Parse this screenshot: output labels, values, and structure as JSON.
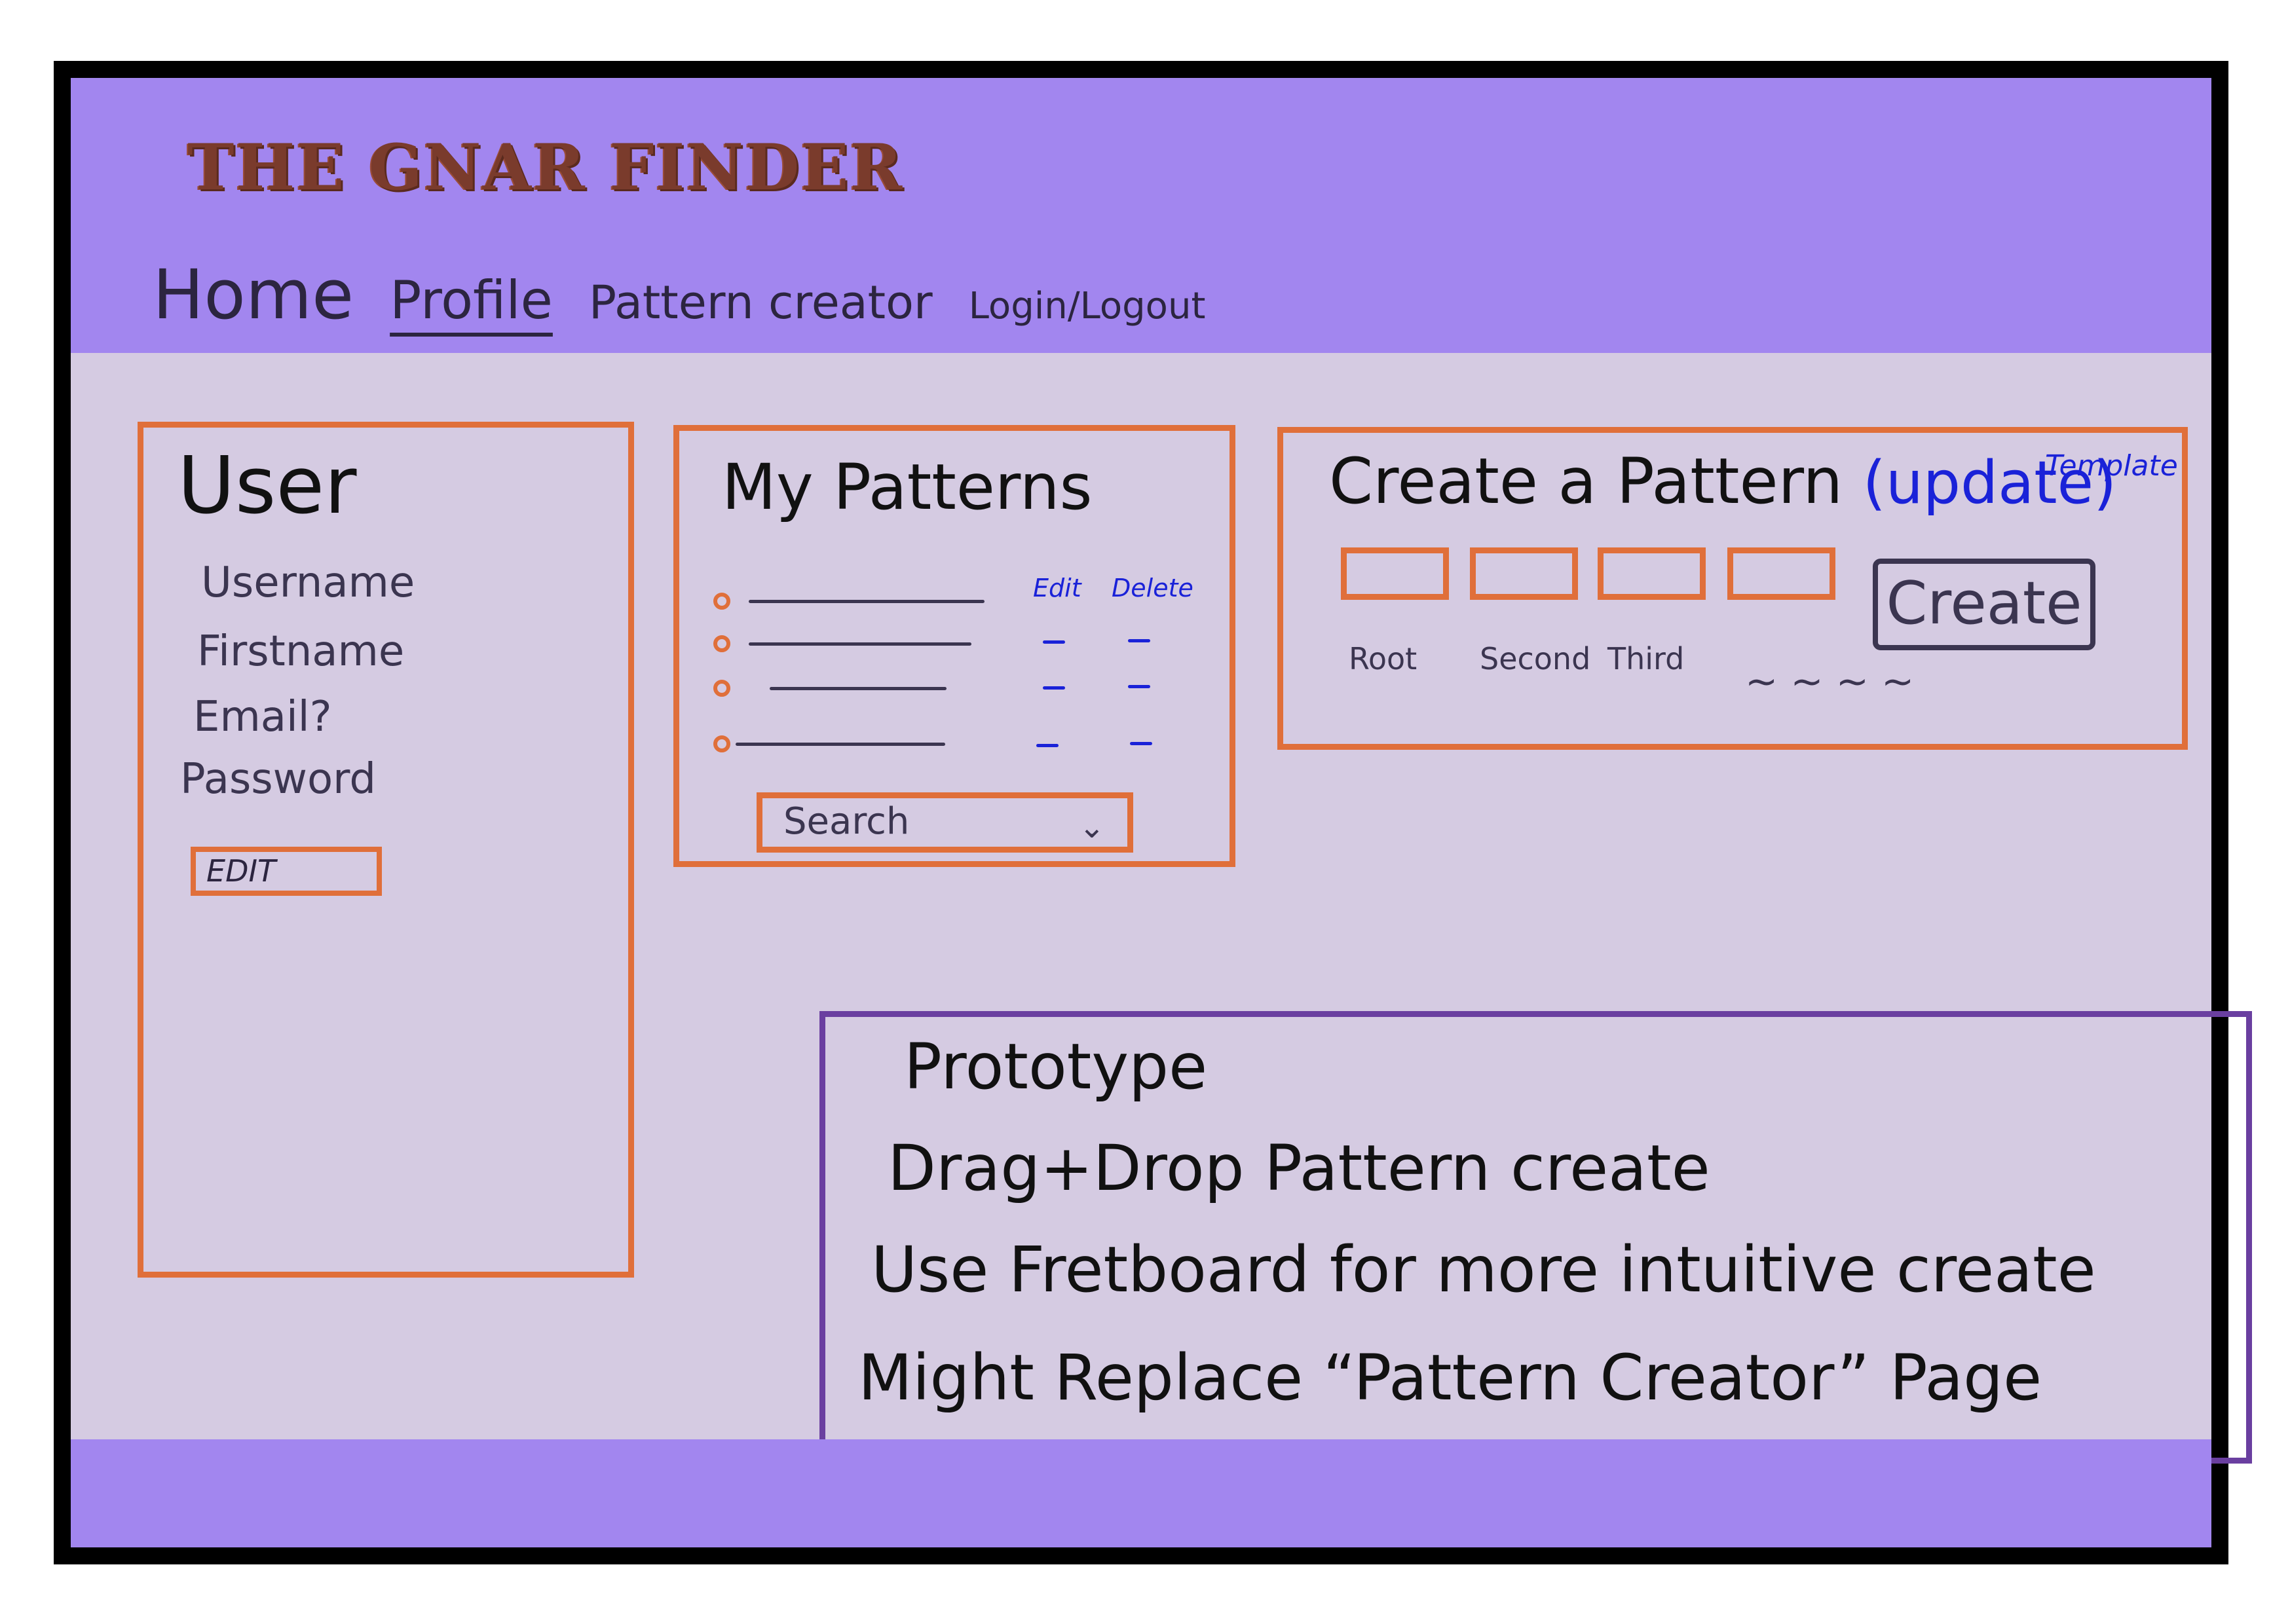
{
  "header": {
    "logo": "THE GNAR FINDER",
    "nav": [
      "Home",
      "Profile",
      "Pattern creator",
      "Login/Logout"
    ]
  },
  "user_panel": {
    "title": "User",
    "fields": [
      "Username",
      "Firstname",
      "Email?",
      "Password"
    ],
    "edit_label": "EDIT"
  },
  "patterns_panel": {
    "title": "My Patterns",
    "edit_col": "Edit",
    "delete_col": "Delete",
    "search_label": "Search",
    "rows": 4
  },
  "create_panel": {
    "title": "Create a Pattern",
    "update_label": "(update)",
    "template_label": "Template",
    "slots": [
      "Root",
      "Second",
      "Third"
    ],
    "more": "~ ~ ~ ~",
    "create_label": "Create"
  },
  "notes": {
    "lines": [
      "Prototype",
      "Drag+Drop Pattern create",
      "Use Fretboard for more intuitive create",
      "Might Replace “Pattern Creator” Page"
    ]
  },
  "colors": {
    "header": "#a286ef",
    "body": "#d5cbe2",
    "box_border": "#e06f3a",
    "notes_border": "#6a3fa0",
    "annotation_blue": "#1a22d8",
    "logo": "#7a3b2c"
  }
}
